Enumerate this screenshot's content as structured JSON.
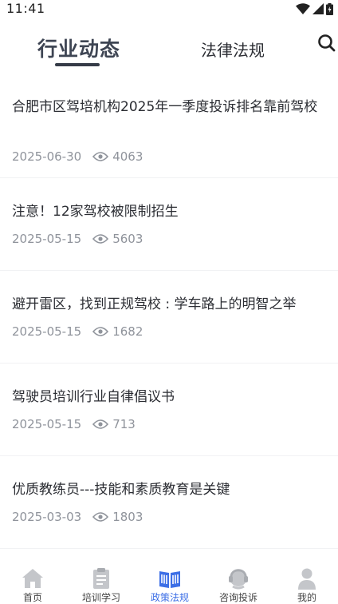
{
  "status_bar": {
    "time": "11:41"
  },
  "header": {
    "tabs": [
      {
        "label": "行业动态",
        "active": true
      },
      {
        "label": "法律法规",
        "active": false
      }
    ]
  },
  "news": [
    {
      "title": "合肥市区驾培机构2025年一季度投诉排名靠前驾校",
      "date": "2025-06-30",
      "views": "4063"
    },
    {
      "title": "注意！12家驾校被限制招生",
      "date": "2025-05-15",
      "views": "5603"
    },
    {
      "title": "避开雷区，找到正规驾校 : 学车路上的明智之举",
      "date": "2025-05-15",
      "views": "1682"
    },
    {
      "title": "驾驶员培训行业自律倡议书",
      "date": "2025-05-15",
      "views": "713"
    },
    {
      "title": "优质教练员---技能和素质教育是关键",
      "date": "2025-03-03",
      "views": "1803"
    }
  ],
  "bottom_nav": {
    "items": [
      {
        "label": "首页",
        "icon": "home-icon",
        "active": false
      },
      {
        "label": "培训学习",
        "icon": "clipboard-icon",
        "active": false
      },
      {
        "label": "政策法规",
        "icon": "book-icon",
        "active": true
      },
      {
        "label": "咨询投诉",
        "icon": "headset-icon",
        "active": false
      },
      {
        "label": "我的",
        "icon": "user-icon",
        "active": false
      }
    ],
    "active_color": "#3d6fe6",
    "inactive_color": "#c4c6ca"
  }
}
